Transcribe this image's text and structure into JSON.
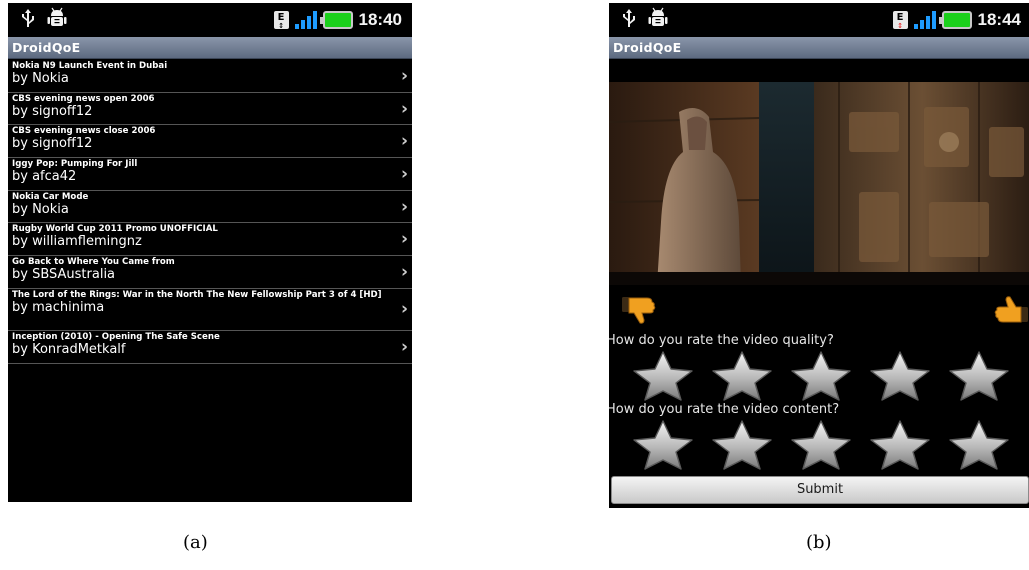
{
  "figure": {
    "caption_a": "(a)",
    "caption_b": "(b)"
  },
  "screen_a": {
    "status_bar": {
      "time": "18:40",
      "network_type": "E",
      "icons": [
        "usb-icon",
        "android-debug-icon",
        "signal-bars-icon",
        "battery-icon"
      ]
    },
    "app_title": "DroidQoE",
    "videos": [
      {
        "title": "Nokia N9 Launch Event in Dubai",
        "author": "by Nokia"
      },
      {
        "title": "CBS evening news open 2006",
        "author": "by signoff12"
      },
      {
        "title": "CBS evening news close 2006",
        "author": "by signoff12"
      },
      {
        "title": "Iggy Pop: Pumping For Jill",
        "author": "by afca42"
      },
      {
        "title": "Nokia Car Mode",
        "author": "by Nokia"
      },
      {
        "title": "Rugby World Cup 2011 Promo UNOFFICIAL",
        "author": "by williamflemingnz"
      },
      {
        "title": "Go Back to Where You Came from",
        "author": "by SBSAustralia"
      },
      {
        "title": "The Lord of the Rings: War in the North The New Fellowship Part 3 of 4 [HD]",
        "author": "by  machinima"
      },
      {
        "title": "Inception (2010) - Opening The Safe Scene",
        "author": "by  KonradMetkalf"
      }
    ],
    "chevron": "›"
  },
  "screen_b": {
    "status_bar": {
      "time": "18:44",
      "network_type": "E",
      "icons": [
        "usb-icon",
        "android-debug-icon",
        "signal-bars-icon",
        "battery-icon"
      ]
    },
    "app_title": "DroidQoE",
    "question_quality": "How do you rate the video quality?",
    "question_content": "How do you rate the video content?",
    "star_count": 5,
    "submit_label": "Submit",
    "icons": [
      "thumbs-down-icon",
      "thumbs-up-icon",
      "star-icon"
    ]
  },
  "colors": {
    "title_bar": "#6f7b90",
    "signal": "#1e9cff",
    "battery": "#1bd01b",
    "thumb": "#f0a020"
  }
}
